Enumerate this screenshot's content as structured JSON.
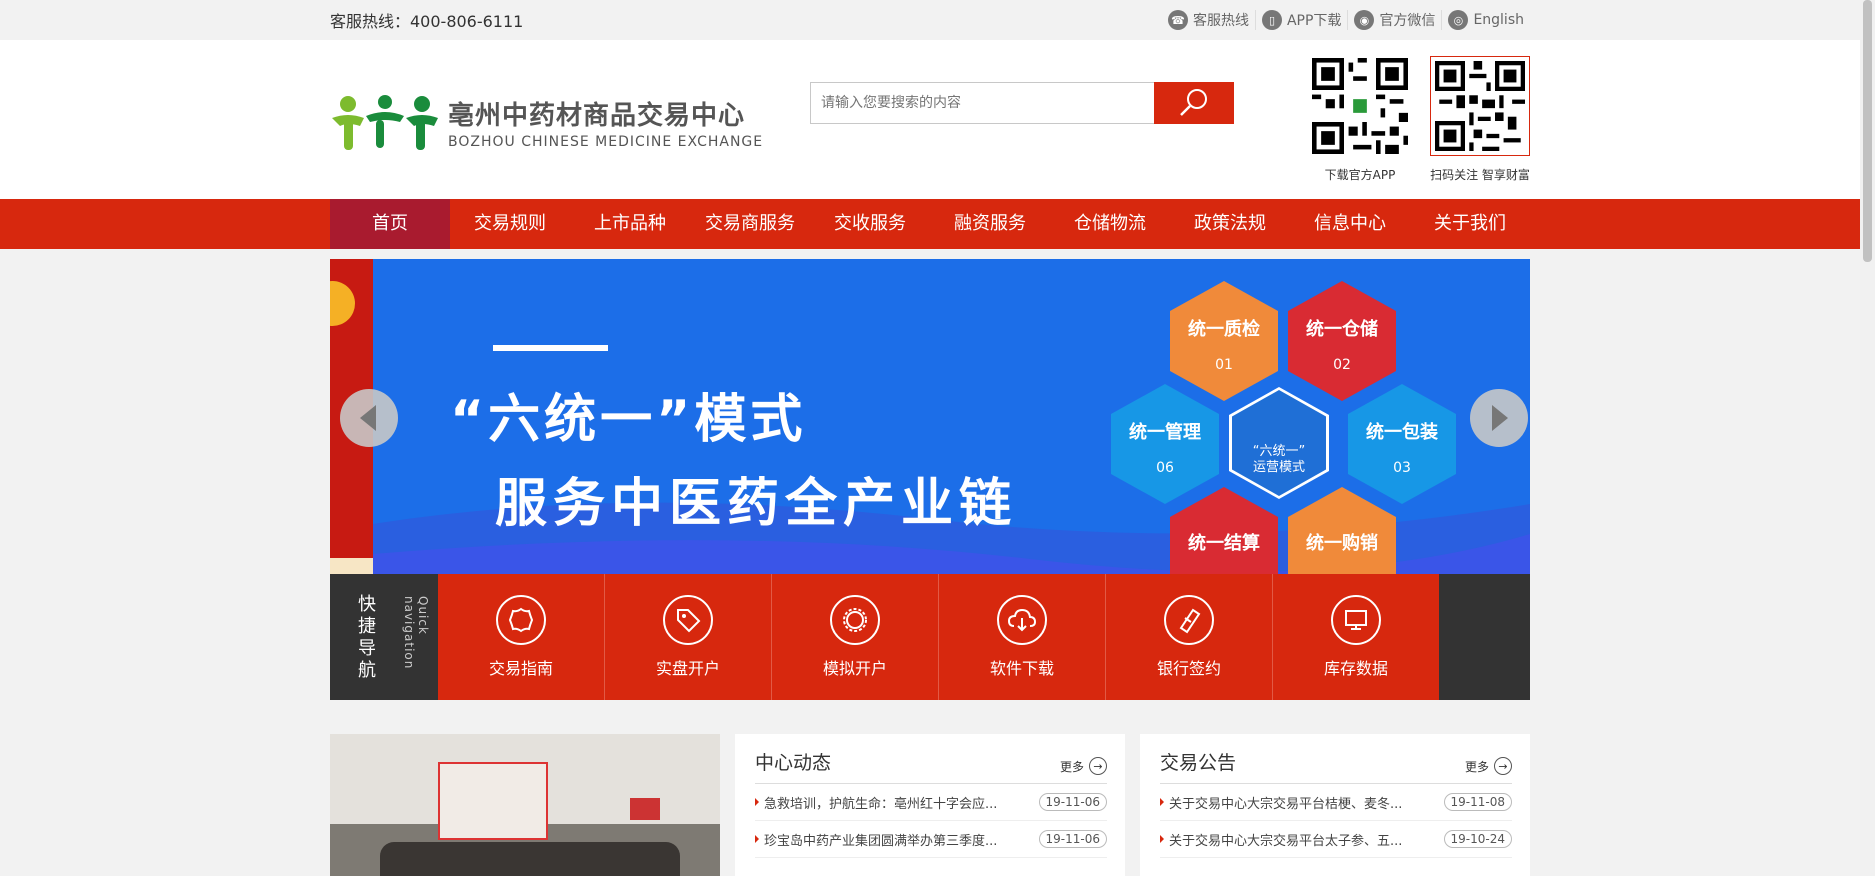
{
  "topbar": {
    "hotline": "客服热线：400-806-6111",
    "links": [
      {
        "label": "客服热线",
        "icon": "phone-icon"
      },
      {
        "label": "APP下载",
        "icon": "mobile-icon"
      },
      {
        "label": "官方微信",
        "icon": "wechat-icon"
      },
      {
        "label": "English",
        "icon": "globe-icon"
      }
    ]
  },
  "header": {
    "logo_cn": "亳州中药材商品交易中心",
    "logo_en": "BOZHOU  CHINESE MEDICINE  EXCHANGE",
    "search_placeholder": "请输入您要搜索的内容",
    "qr1_caption": "下载官方APP",
    "qr2_caption": "扫码关注 智享财富"
  },
  "nav": {
    "items": [
      "首页",
      "交易规则",
      "上市品种",
      "交易商服务",
      "交收服务",
      "融资服务",
      "仓储物流",
      "政策法规",
      "信息中心",
      "关于我们"
    ],
    "active_index": 0
  },
  "banner": {
    "title1": "“六统一”模式",
    "title2": "服务中医药全产业链",
    "center_label_1": "“六统一”",
    "center_label_2": "运营模式",
    "hexes": [
      {
        "label": "统一质检",
        "num": "01"
      },
      {
        "label": "统一仓储",
        "num": "02"
      },
      {
        "label": "统一包装",
        "num": "03"
      },
      {
        "label": "统一购销",
        "num": ""
      },
      {
        "label": "统一结算",
        "num": ""
      },
      {
        "label": "统一管理",
        "num": "06"
      }
    ]
  },
  "quick_nav": {
    "label_cn": "快捷导航",
    "label_en": "Quick navigation",
    "items": [
      "交易指南",
      "实盘开户",
      "模拟开户",
      "软件下载",
      "银行签约",
      "库存数据"
    ]
  },
  "news_center": {
    "title": "中心动态",
    "more": "更多",
    "items": [
      {
        "title": "急救培训，护航生命：亳州红十字会应...",
        "date": "19-11-06"
      },
      {
        "title": "珍宝岛中药产业集团圆满举办第三季度...",
        "date": "19-11-06"
      }
    ]
  },
  "announcements": {
    "title": "交易公告",
    "more": "更多",
    "items": [
      {
        "title": "关于交易中心大宗交易平台桔梗、麦冬...",
        "date": "19-11-08"
      },
      {
        "title": "关于交易中心大宗交易平台太子参、五...",
        "date": "19-10-24"
      }
    ]
  },
  "colors": {
    "brand_red": "#d7280e",
    "nav_active": "#a91b2f",
    "dark": "#333333",
    "banner_blue": "#1c6ee8"
  }
}
